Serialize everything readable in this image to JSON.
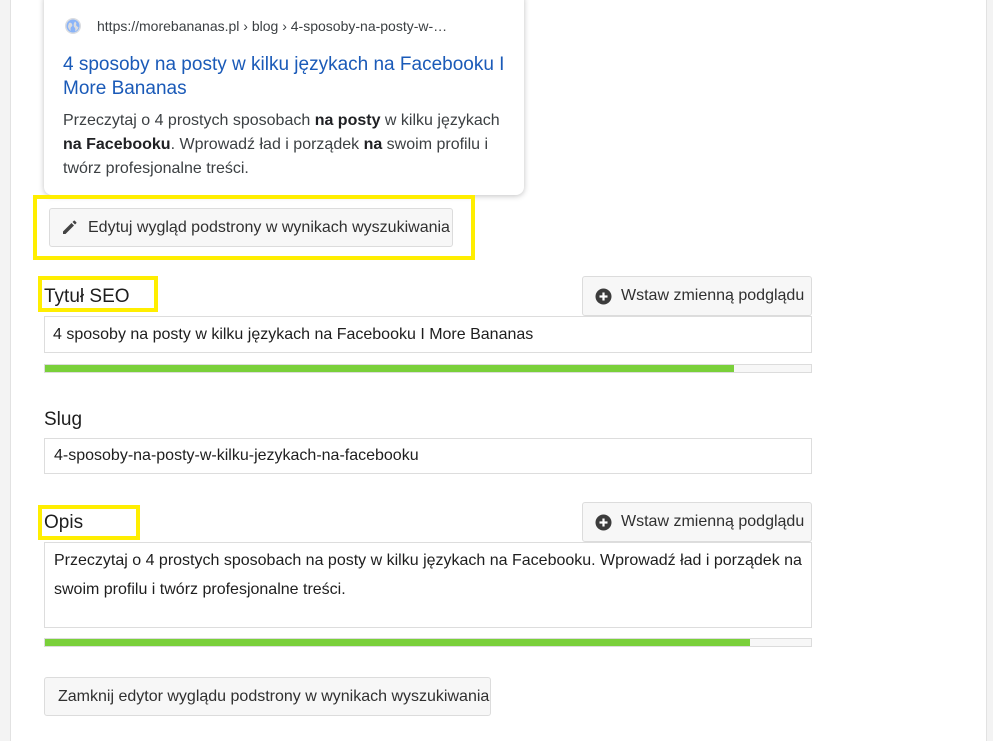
{
  "preview": {
    "url": "https://morebananas.pl › blog › 4-sposoby-na-posty-w-…",
    "title": "4 sposoby na posty w kilku językach na Facebooku I More Bananas",
    "desc": {
      "p1": "Przeczytaj o 4 prostych sposobach ",
      "b1": "na posty",
      "p2": " w kilku językach ",
      "b2": "na Facebooku",
      "p3": ". Wprowadź ład i porządek ",
      "b3": "na",
      "p4": " swoim profilu i twórz profesjonalne treści."
    }
  },
  "edit_button_label": "Edytuj wygląd podstrony w wynikach wyszukiwania",
  "seo_title": {
    "label": "Tytuł SEO",
    "insert_variable_label": "Wstaw zmienną podglądu",
    "value": "4 sposoby na posty w kilku językach na Facebooku I More Bananas",
    "progress_fraction": 0.9
  },
  "slug": {
    "label": "Slug",
    "value": "4-sposoby-na-posty-w-kilku-jezykach-na-facebooku"
  },
  "description": {
    "label": "Opis",
    "insert_variable_label": "Wstaw zmienną podglądu",
    "value": "Przeczytaj o 4 prostych sposobach na posty w kilku językach na Facebooku. Wprowadź ład i porządek na swoim profilu i twórz profesjonalne treści.",
    "progress_fraction": 0.92
  },
  "close_button_label": "Zamknij edytor wyglądu podstrony w wynikach wyszukiwania",
  "colors": {
    "highlight": "#ffee00",
    "progress_good": "#7ad03a",
    "link_title": "#1a5ab8"
  }
}
